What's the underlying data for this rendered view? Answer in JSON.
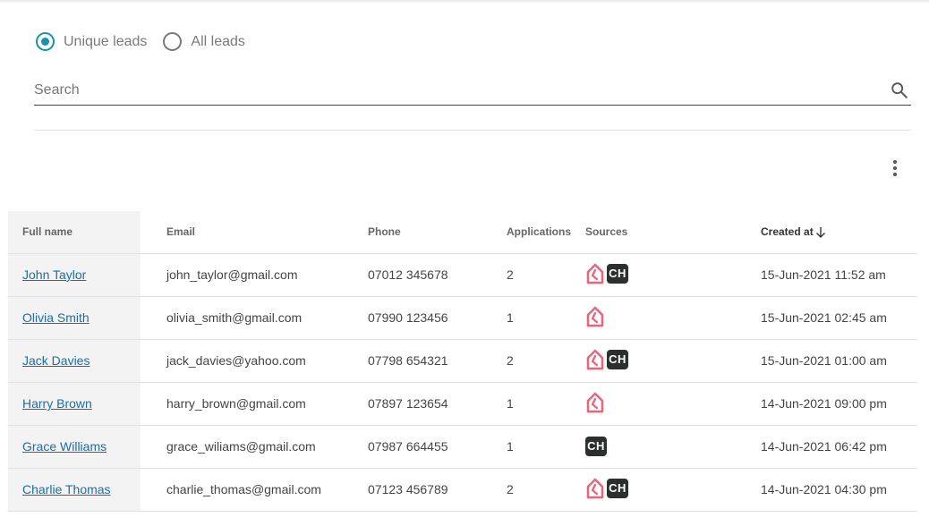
{
  "filters": {
    "unique_label": "Unique leads",
    "all_label": "All leads",
    "selected": "unique"
  },
  "search": {
    "placeholder": "Search",
    "value": ""
  },
  "colors": {
    "accent": "#1a8fb0",
    "link": "#1a6fa8",
    "source_house": "#e8677a",
    "source_ch": "#2b2f2e"
  },
  "table": {
    "headers": {
      "full_name": "Full name",
      "email": "Email",
      "phone": "Phone",
      "applications": "Applications",
      "sources": "Sources",
      "created_at": "Created at"
    },
    "sort": {
      "column": "created_at",
      "direction": "desc"
    },
    "rows": [
      {
        "name": "John Taylor",
        "email": "john_taylor@gmail.com",
        "phone": "07012 345678",
        "applications": "2",
        "sources": [
          "house-icon",
          "CH"
        ],
        "created": "15-Jun-2021 11:52 am"
      },
      {
        "name": "Olivia Smith",
        "email": "olivia_smith@gmail.com",
        "phone": "07990 123456",
        "applications": "1",
        "sources": [
          "house-icon"
        ],
        "created": "15-Jun-2021 02:45 am"
      },
      {
        "name": "Jack Davies",
        "email": "jack_davies@yahoo.com",
        "phone": "07798 654321",
        "applications": "2",
        "sources": [
          "house-icon",
          "CH"
        ],
        "created": "15-Jun-2021 01:00 am"
      },
      {
        "name": "Harry Brown",
        "email": "harry_brown@gmail.com",
        "phone": "07897 123654",
        "applications": "1",
        "sources": [
          "house-icon"
        ],
        "created": "14-Jun-2021 09:00 pm"
      },
      {
        "name": "Grace Williams",
        "email": "grace_wiliams@gmail.com",
        "phone": "07987 664455",
        "applications": "1",
        "sources": [
          "CH"
        ],
        "created": "14-Jun-2021 06:42 pm"
      },
      {
        "name": "Charlie Thomas",
        "email": "charlie_thomas@gmail.com",
        "phone": "07123 456789",
        "applications": "2",
        "sources": [
          "house-icon",
          "CH"
        ],
        "created": "14-Jun-2021 04:30 pm"
      }
    ]
  }
}
